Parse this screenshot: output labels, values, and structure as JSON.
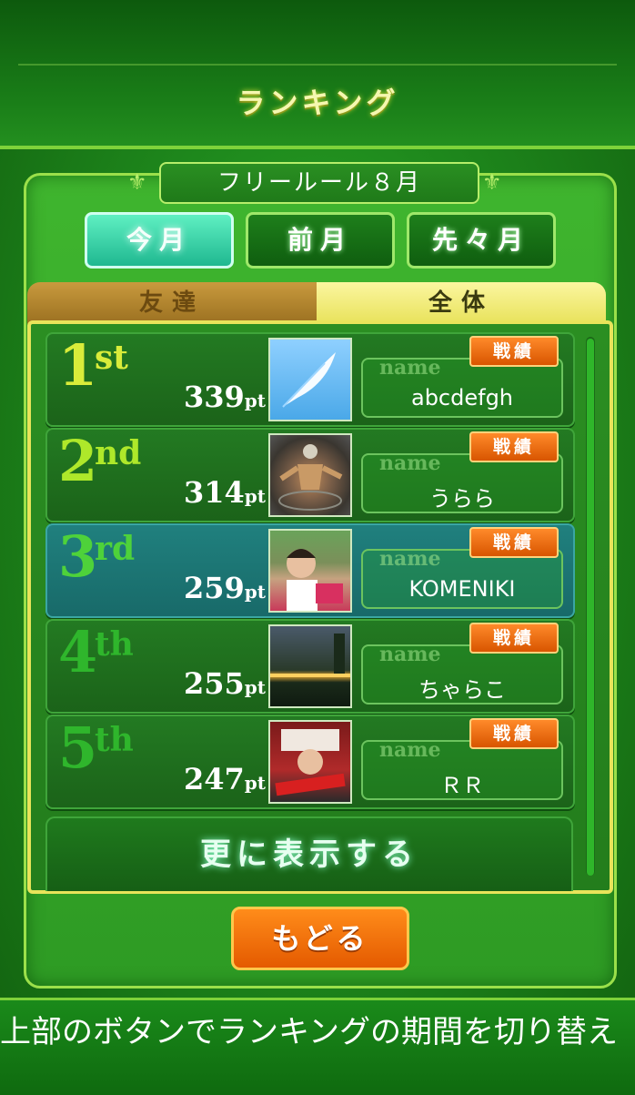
{
  "header": {
    "title": "ランキング"
  },
  "period": {
    "label": "フリールール８月",
    "buttons": [
      {
        "label": "今月",
        "active": true
      },
      {
        "label": "前月",
        "active": false
      },
      {
        "label": "先々月",
        "active": false
      }
    ]
  },
  "tabs": [
    {
      "label": "友達",
      "active": false
    },
    {
      "label": "全体",
      "active": true
    }
  ],
  "rankings": [
    {
      "rank": "1",
      "suffix": "st",
      "score": "339",
      "unit": "pt",
      "name_tag": "name",
      "name": "abcdefgh",
      "stats_label": "戦績",
      "avatar": "feather-icon",
      "rank_color": "#d9ec3a",
      "highlight": false
    },
    {
      "rank": "2",
      "suffix": "nd",
      "score": "314",
      "unit": "pt",
      "name_tag": "name",
      "name": "うらら",
      "stats_label": "戦績",
      "avatar": "statue-photo",
      "rank_color": "#aee82a",
      "highlight": false
    },
    {
      "rank": "3",
      "suffix": "rd",
      "score": "259",
      "unit": "pt",
      "name_tag": "name",
      "name": "KOMENIKI",
      "stats_label": "戦績",
      "avatar": "child-photo",
      "rank_color": "#4ed23a",
      "highlight": true
    },
    {
      "rank": "4",
      "suffix": "th",
      "score": "255",
      "unit": "pt",
      "name_tag": "name",
      "name": "ちゃらこ",
      "stats_label": "戦績",
      "avatar": "night-road-photo",
      "rank_color": "#2fb62c",
      "highlight": false
    },
    {
      "rank": "5",
      "suffix": "th",
      "score": "247",
      "unit": "pt",
      "name_tag": "name",
      "name": "ＲＲ",
      "stats_label": "戦績",
      "avatar": "red-ribbon-logo",
      "rank_color": "#2fb62c",
      "highlight": false
    }
  ],
  "more_button": "更に表示する",
  "back_button": "もどる",
  "footer": {
    "message": "上部のボタンでランキングの期間を切り替え"
  }
}
